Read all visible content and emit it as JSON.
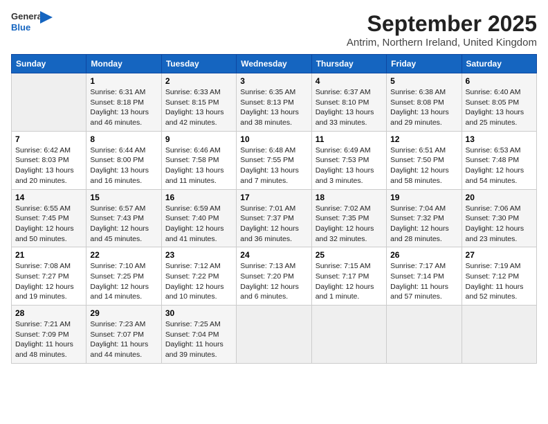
{
  "header": {
    "logo_general": "General",
    "logo_blue": "Blue",
    "month_year": "September 2025",
    "location": "Antrim, Northern Ireland, United Kingdom"
  },
  "days_of_week": [
    "Sunday",
    "Monday",
    "Tuesday",
    "Wednesday",
    "Thursday",
    "Friday",
    "Saturday"
  ],
  "weeks": [
    [
      {
        "num": "",
        "info": ""
      },
      {
        "num": "1",
        "info": "Sunrise: 6:31 AM\nSunset: 8:18 PM\nDaylight: 13 hours\nand 46 minutes."
      },
      {
        "num": "2",
        "info": "Sunrise: 6:33 AM\nSunset: 8:15 PM\nDaylight: 13 hours\nand 42 minutes."
      },
      {
        "num": "3",
        "info": "Sunrise: 6:35 AM\nSunset: 8:13 PM\nDaylight: 13 hours\nand 38 minutes."
      },
      {
        "num": "4",
        "info": "Sunrise: 6:37 AM\nSunset: 8:10 PM\nDaylight: 13 hours\nand 33 minutes."
      },
      {
        "num": "5",
        "info": "Sunrise: 6:38 AM\nSunset: 8:08 PM\nDaylight: 13 hours\nand 29 minutes."
      },
      {
        "num": "6",
        "info": "Sunrise: 6:40 AM\nSunset: 8:05 PM\nDaylight: 13 hours\nand 25 minutes."
      }
    ],
    [
      {
        "num": "7",
        "info": "Sunrise: 6:42 AM\nSunset: 8:03 PM\nDaylight: 13 hours\nand 20 minutes."
      },
      {
        "num": "8",
        "info": "Sunrise: 6:44 AM\nSunset: 8:00 PM\nDaylight: 13 hours\nand 16 minutes."
      },
      {
        "num": "9",
        "info": "Sunrise: 6:46 AM\nSunset: 7:58 PM\nDaylight: 13 hours\nand 11 minutes."
      },
      {
        "num": "10",
        "info": "Sunrise: 6:48 AM\nSunset: 7:55 PM\nDaylight: 13 hours\nand 7 minutes."
      },
      {
        "num": "11",
        "info": "Sunrise: 6:49 AM\nSunset: 7:53 PM\nDaylight: 13 hours\nand 3 minutes."
      },
      {
        "num": "12",
        "info": "Sunrise: 6:51 AM\nSunset: 7:50 PM\nDaylight: 12 hours\nand 58 minutes."
      },
      {
        "num": "13",
        "info": "Sunrise: 6:53 AM\nSunset: 7:48 PM\nDaylight: 12 hours\nand 54 minutes."
      }
    ],
    [
      {
        "num": "14",
        "info": "Sunrise: 6:55 AM\nSunset: 7:45 PM\nDaylight: 12 hours\nand 50 minutes."
      },
      {
        "num": "15",
        "info": "Sunrise: 6:57 AM\nSunset: 7:43 PM\nDaylight: 12 hours\nand 45 minutes."
      },
      {
        "num": "16",
        "info": "Sunrise: 6:59 AM\nSunset: 7:40 PM\nDaylight: 12 hours\nand 41 minutes."
      },
      {
        "num": "17",
        "info": "Sunrise: 7:01 AM\nSunset: 7:37 PM\nDaylight: 12 hours\nand 36 minutes."
      },
      {
        "num": "18",
        "info": "Sunrise: 7:02 AM\nSunset: 7:35 PM\nDaylight: 12 hours\nand 32 minutes."
      },
      {
        "num": "19",
        "info": "Sunrise: 7:04 AM\nSunset: 7:32 PM\nDaylight: 12 hours\nand 28 minutes."
      },
      {
        "num": "20",
        "info": "Sunrise: 7:06 AM\nSunset: 7:30 PM\nDaylight: 12 hours\nand 23 minutes."
      }
    ],
    [
      {
        "num": "21",
        "info": "Sunrise: 7:08 AM\nSunset: 7:27 PM\nDaylight: 12 hours\nand 19 minutes."
      },
      {
        "num": "22",
        "info": "Sunrise: 7:10 AM\nSunset: 7:25 PM\nDaylight: 12 hours\nand 14 minutes."
      },
      {
        "num": "23",
        "info": "Sunrise: 7:12 AM\nSunset: 7:22 PM\nDaylight: 12 hours\nand 10 minutes."
      },
      {
        "num": "24",
        "info": "Sunrise: 7:13 AM\nSunset: 7:20 PM\nDaylight: 12 hours\nand 6 minutes."
      },
      {
        "num": "25",
        "info": "Sunrise: 7:15 AM\nSunset: 7:17 PM\nDaylight: 12 hours\nand 1 minute."
      },
      {
        "num": "26",
        "info": "Sunrise: 7:17 AM\nSunset: 7:14 PM\nDaylight: 11 hours\nand 57 minutes."
      },
      {
        "num": "27",
        "info": "Sunrise: 7:19 AM\nSunset: 7:12 PM\nDaylight: 11 hours\nand 52 minutes."
      }
    ],
    [
      {
        "num": "28",
        "info": "Sunrise: 7:21 AM\nSunset: 7:09 PM\nDaylight: 11 hours\nand 48 minutes."
      },
      {
        "num": "29",
        "info": "Sunrise: 7:23 AM\nSunset: 7:07 PM\nDaylight: 11 hours\nand 44 minutes."
      },
      {
        "num": "30",
        "info": "Sunrise: 7:25 AM\nSunset: 7:04 PM\nDaylight: 11 hours\nand 39 minutes."
      },
      {
        "num": "",
        "info": ""
      },
      {
        "num": "",
        "info": ""
      },
      {
        "num": "",
        "info": ""
      },
      {
        "num": "",
        "info": ""
      }
    ]
  ]
}
